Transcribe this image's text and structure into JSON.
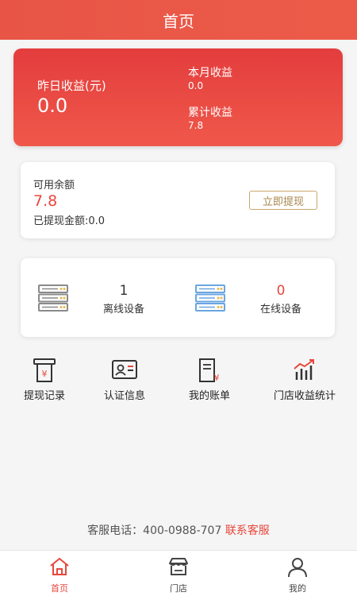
{
  "header": {
    "title": "首页"
  },
  "earnings": {
    "yesterday_label": "昨日收益(元)",
    "yesterday_value": "0.0",
    "month_label": "本月收益",
    "month_value": "0.0",
    "total_label": "累计收益",
    "total_value": "7.8"
  },
  "balance": {
    "label": "可用余额",
    "value": "7.8",
    "withdrawn_text": "已提现金额:0.0",
    "withdraw_button": "立即提现"
  },
  "devices": {
    "offline": {
      "count": "1",
      "label": "离线设备",
      "icon": "server-icon"
    },
    "online": {
      "count": "0",
      "label": "在线设备",
      "icon": "server-icon"
    }
  },
  "shortcuts": [
    {
      "label": "提现记录",
      "icon": "atm-withdraw-icon"
    },
    {
      "label": "认证信息",
      "icon": "id-card-icon"
    },
    {
      "label": "我的账单",
      "icon": "bill-icon"
    },
    {
      "label": "门店收益统计",
      "icon": "bar-chart-icon"
    }
  ],
  "service": {
    "prefix": "客服电话：400-0988-707",
    "contact_link": "联系客服"
  },
  "tabbar": [
    {
      "label": "首页",
      "icon": "home-icon",
      "active": true
    },
    {
      "label": "门店",
      "icon": "store-icon",
      "active": false
    },
    {
      "label": "我的",
      "icon": "user-icon",
      "active": false
    }
  ],
  "colors": {
    "accent": "#e8473c",
    "header": "#ea5746",
    "gold_button": "#c9a66b",
    "offline_icon": "#8a8a8a",
    "online_icon": "#6aa6e0"
  }
}
